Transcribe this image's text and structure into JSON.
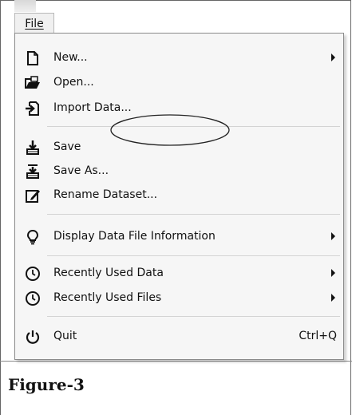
{
  "menu_bar": {
    "file_label": "File"
  },
  "menu": {
    "items": [
      {
        "label": "New...",
        "icon": "new-file-icon",
        "submenu": true
      },
      {
        "label": "Open...",
        "icon": "open-folder-icon"
      },
      {
        "label": "Import Data...",
        "icon": "import-icon"
      },
      {
        "label": "Save",
        "icon": "save-icon"
      },
      {
        "label": "Save As...",
        "icon": "save-as-icon"
      },
      {
        "label": "Rename Dataset...",
        "icon": "rename-icon"
      },
      {
        "label": "Display Data File Information",
        "icon": "lightbulb-icon",
        "submenu": true
      },
      {
        "label": "Recently Used Data",
        "icon": "clock-icon",
        "submenu": true
      },
      {
        "label": "Recently Used Files",
        "icon": "clock-icon",
        "submenu": true
      },
      {
        "label": "Quit",
        "icon": "power-icon",
        "shortcut": "Ctrl+Q"
      }
    ]
  },
  "caption": "Figure-3"
}
